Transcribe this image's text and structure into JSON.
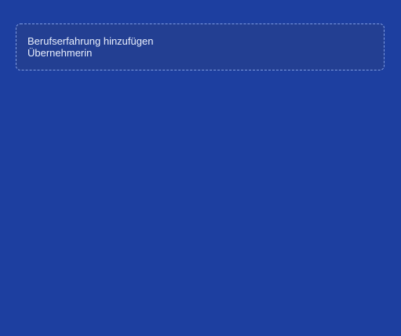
{
  "dialog": {
    "title": "Berufserfahrung hinzufügen"
  },
  "fields": {
    "title_value": "Übernehmerin"
  }
}
